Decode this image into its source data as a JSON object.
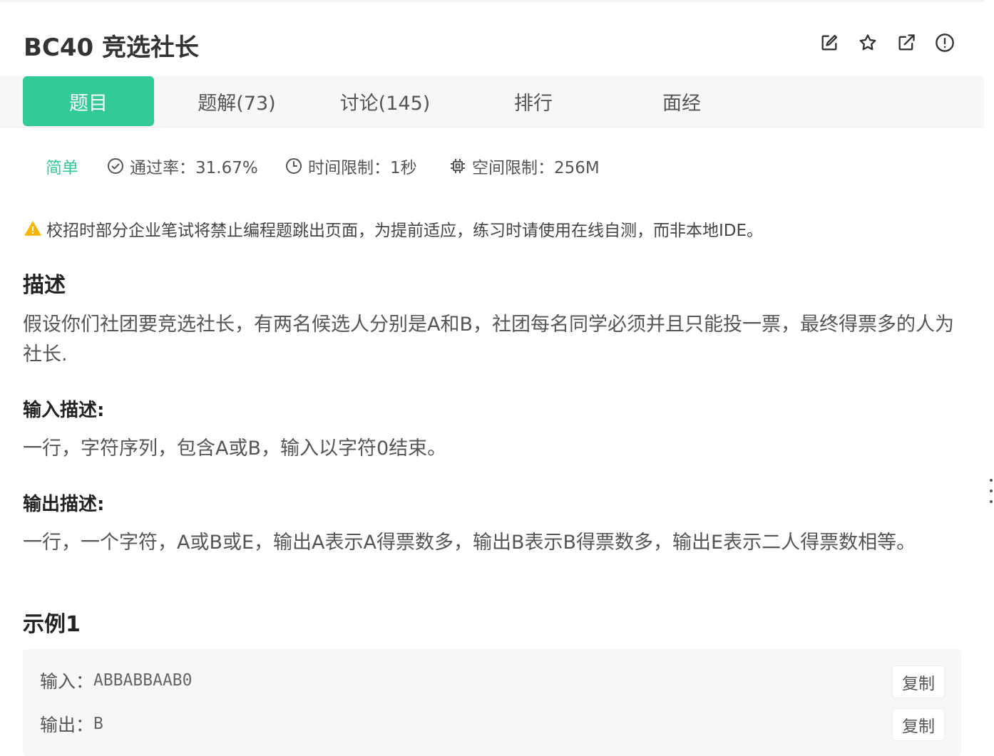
{
  "header": {
    "title": "BC40  竞选社长",
    "icons": [
      "edit-icon",
      "star-icon",
      "open-external-icon",
      "alert-circle-icon"
    ]
  },
  "tabs": [
    {
      "label": "题目",
      "active": true
    },
    {
      "label": "题解(73)",
      "active": false
    },
    {
      "label": "讨论(145)",
      "active": false
    },
    {
      "label": "排行",
      "active": false
    },
    {
      "label": "面经",
      "active": false
    }
  ],
  "meta": {
    "difficulty": "简单",
    "pass_rate": "通过率：31.67%",
    "time_limit": "时间限制：1秒",
    "space_limit": "空间限制：256M"
  },
  "warning": "校招时部分企业笔试将禁止编程题跳出页面，为提前适应，练习时请使用在线自测，而非本地IDE。",
  "description": {
    "heading": "描述",
    "text": "假设你们社团要竞选社长，有两名候选人分别是A和B，社团每名同学必须并且只能投一票，最终得票多的人为社长."
  },
  "input_desc": {
    "heading": "输入描述:",
    "text": "一行，字符序列，包含A或B，输入以字符0结束。"
  },
  "output_desc": {
    "heading": "输出描述:",
    "text": "一行，一个字符，A或B或E，输出A表示A得票数多，输出B表示B得票数多，输出E表示二人得票数相等。"
  },
  "example": {
    "heading": "示例1",
    "input_label": "输入：",
    "input_value": "ABBABBAAB0",
    "output_label": "输出：",
    "output_value": "B",
    "copy_label": "复制"
  },
  "colors": {
    "accent": "#32ca99",
    "tab_bg": "#f6f7f9",
    "warning": "#f7b500"
  }
}
